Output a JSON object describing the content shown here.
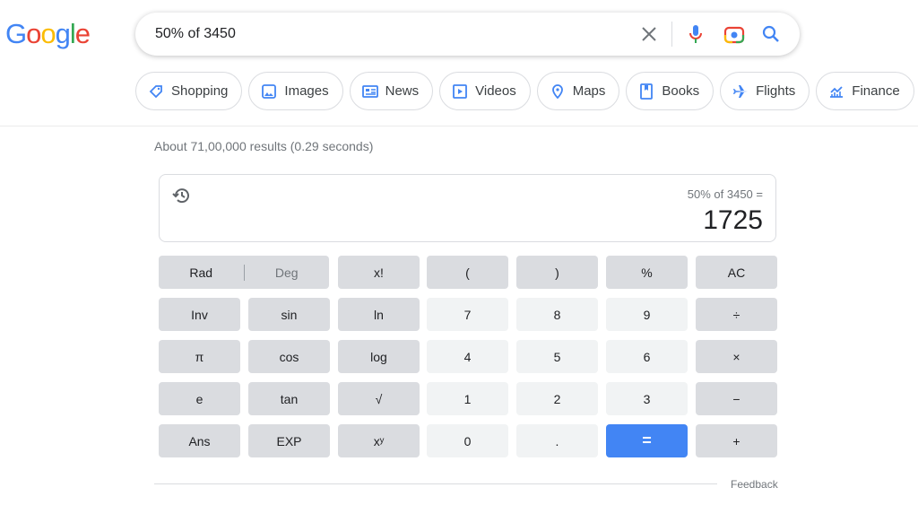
{
  "logo": {
    "text": "Google",
    "colors": [
      "#4285f4",
      "#ea4335",
      "#fbbc05",
      "#4285f4",
      "#34a853",
      "#ea4335"
    ]
  },
  "search": {
    "query": "50% of 3450",
    "icons": [
      "close-icon",
      "mic-icon",
      "camera-icon",
      "search-icon"
    ]
  },
  "chips": [
    {
      "label": "Shopping",
      "icon": "tag-icon"
    },
    {
      "label": "Images",
      "icon": "image-icon"
    },
    {
      "label": "News",
      "icon": "news-icon"
    },
    {
      "label": "Videos",
      "icon": "video-icon"
    },
    {
      "label": "Maps",
      "icon": "map-pin-icon"
    },
    {
      "label": "Books",
      "icon": "book-icon"
    },
    {
      "label": "Flights",
      "icon": "plane-icon"
    },
    {
      "label": "Finance",
      "icon": "finance-icon"
    }
  ],
  "stats": "About 71,00,000 results (0.29 seconds)",
  "calculator": {
    "expression": "50% of 3450 =",
    "result": "1725",
    "rad": "Rad",
    "deg": "Deg",
    "buttons": [
      [
        "x!",
        "(",
        ")",
        "%",
        "AC"
      ],
      [
        "Inv",
        "sin",
        "ln",
        "7",
        "8",
        "9",
        "÷"
      ],
      [
        "π",
        "cos",
        "log",
        "4",
        "5",
        "6",
        "×"
      ],
      [
        "e",
        "tan",
        "√",
        "1",
        "2",
        "3",
        "−"
      ],
      [
        "Ans",
        "EXP",
        "xʸ",
        "0",
        ".",
        "=",
        "+"
      ]
    ],
    "accent": "#4285f4"
  },
  "feedback": "Feedback"
}
